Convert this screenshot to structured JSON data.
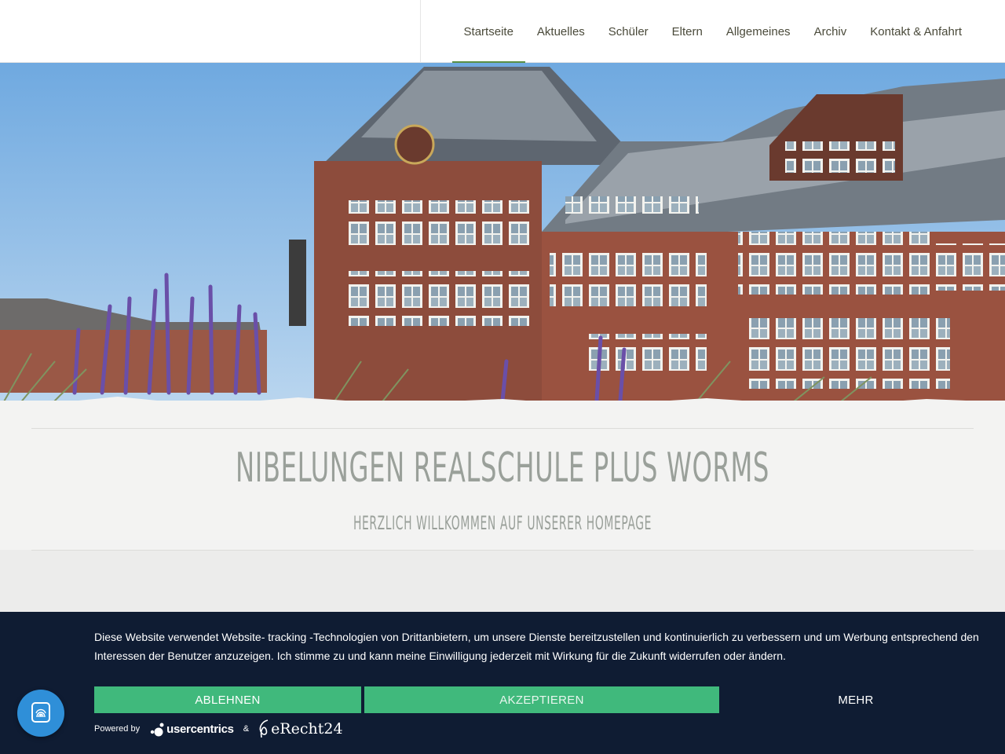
{
  "nav": {
    "items": [
      {
        "label": "Startseite",
        "active": true
      },
      {
        "label": "Aktuelles",
        "active": false
      },
      {
        "label": "Schüler",
        "active": false
      },
      {
        "label": "Eltern",
        "active": false
      },
      {
        "label": "Allgemeines",
        "active": false
      },
      {
        "label": "Archiv",
        "active": false
      },
      {
        "label": "Kontakt & Anfahrt",
        "active": false
      }
    ]
  },
  "hero": {
    "image": "school-building-photo"
  },
  "site": {
    "title": "NIBELUNGEN REALSCHULE PLUS WORMS",
    "subtitle": "HERZLICH WILLKOMMEN AUF UNSERER HOMEPAGE"
  },
  "cookie": {
    "text": "Diese Website verwendet Website- tracking -Technologien von Drittanbietern, um unsere Dienste bereitzustellen und kontinuierlich zu verbessern und um Werbung entsprechend den Interessen der Benutzer anzuzeigen. Ich stimme zu und kann meine Einwilligung jederzeit mit Wirkung für die Zukunft widerrufen oder ändern.",
    "decline_label": "ABLEHNEN",
    "accept_label": "AKZEPTIEREN",
    "more_label": "MEHR",
    "powered_by": "Powered by",
    "usercentrics": "usercentrics",
    "amp": "&",
    "erecht": "eRecht24"
  },
  "colors": {
    "accent": "#5a8f43",
    "banner": "#0f1c33",
    "button": "#40b97c",
    "fingerprint": "#2f8fd8"
  },
  "icons": [
    "fingerprint-icon",
    "usercentrics-logo-icon",
    "erecht24-logo-icon"
  ]
}
